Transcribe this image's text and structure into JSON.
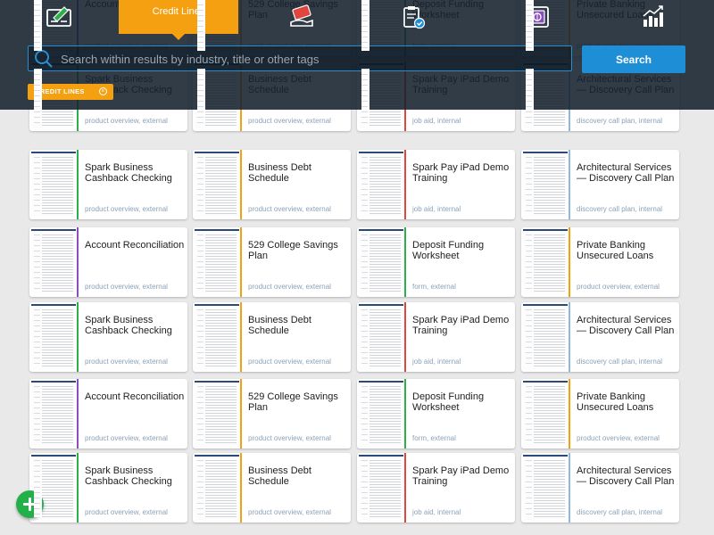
{
  "colors": {
    "purple": "#8a4fbf",
    "orange": "#f5a011",
    "green": "#2bb04a",
    "red": "#e0463e",
    "blue": "#8fb8e0",
    "accent": "#1e8fd6"
  },
  "nav": {
    "tabs": [
      {
        "icon": "check-form-icon"
      },
      {
        "label": "Credit Lines",
        "icon": null,
        "active": true
      },
      {
        "icon": "card-hand-icon"
      },
      {
        "icon": "clipboard-check-icon"
      },
      {
        "icon": "vault-safe-icon"
      },
      {
        "icon": "growth-chart-icon"
      }
    ]
  },
  "search": {
    "placeholder": "Search within results by industry, title or other tags",
    "button_label": "Search"
  },
  "filters": [
    {
      "label": "CREDIT LINES"
    }
  ],
  "cards": [
    {
      "title": "Spark Business Cashback Checking",
      "tags": "product overview, external",
      "color": "green"
    },
    {
      "title": "Business Debt Schedule",
      "tags": "product overview, external",
      "color": "orange"
    },
    {
      "title": "Spark Pay iPad Demo Training",
      "tags": "job aid, internal",
      "color": "red"
    },
    {
      "title": "Architectural Services — Discovery Call Plan",
      "tags": "discovery call plan, internal",
      "color": "blue"
    },
    {
      "title": "Account Reconciliation",
      "tags": "product overview, external",
      "color": "purple"
    },
    {
      "title": "529 College Savings Plan",
      "tags": "product overview, external",
      "color": "orange"
    },
    {
      "title": "Deposit Funding Worksheet",
      "tags": "form, external",
      "color": "green"
    },
    {
      "title": "Private Banking Unsecured Loans",
      "tags": "product overview, external",
      "color": "orange"
    },
    {
      "title": "Spark Business Cashback Checking",
      "tags": "product overview, external",
      "color": "green"
    },
    {
      "title": "Business Debt Schedule",
      "tags": "product overview, external",
      "color": "orange"
    },
    {
      "title": "Spark Pay iPad Demo Training",
      "tags": "job aid, internal",
      "color": "red"
    },
    {
      "title": "Architectural Services — Discovery Call Plan",
      "tags": "discovery call plan, internal",
      "color": "blue"
    },
    {
      "title": "Account Reconciliation",
      "tags": "product overview, external",
      "color": "purple"
    },
    {
      "title": "529 College Savings Plan",
      "tags": "product overview, external",
      "color": "orange"
    },
    {
      "title": "Deposit Funding Worksheet",
      "tags": "form, external",
      "color": "green"
    },
    {
      "title": "Private Banking Unsecured Loans",
      "tags": "product overview, external",
      "color": "orange"
    },
    {
      "title": "Spark Business Cashback Checking",
      "tags": "product overview, external",
      "color": "green"
    },
    {
      "title": "Business Debt Schedule",
      "tags": "product overview, external",
      "color": "orange"
    },
    {
      "title": "Spark Pay iPad Demo Training",
      "tags": "job aid, internal",
      "color": "red"
    },
    {
      "title": "Architectural Services — Discovery Call Plan",
      "tags": "discovery call plan, internal",
      "color": "blue"
    },
    {
      "title": "Account Reconciliation",
      "tags": "product overview, external",
      "color": "purple"
    },
    {
      "title": "529 College Savings Plan",
      "tags": "product overview, external",
      "color": "orange"
    },
    {
      "title": "Deposit Funding Worksheet",
      "tags": "form, external",
      "color": "green"
    },
    {
      "title": "Private Banking Unsecured Loans",
      "tags": "product overview, external",
      "color": "orange"
    },
    {
      "title": "Spark Business Cashback Checking",
      "tags": "product overview, external",
      "color": "green"
    },
    {
      "title": "Business Debt Schedule",
      "tags": "product overview, external",
      "color": "orange"
    },
    {
      "title": "Spark Pay iPad Demo Training",
      "tags": "job aid, internal",
      "color": "red"
    },
    {
      "title": "Architectural Services — Discovery Call Plan",
      "tags": "discovery call plan, internal",
      "color": "blue"
    }
  ],
  "fab": {
    "icon": "plus-icon"
  }
}
